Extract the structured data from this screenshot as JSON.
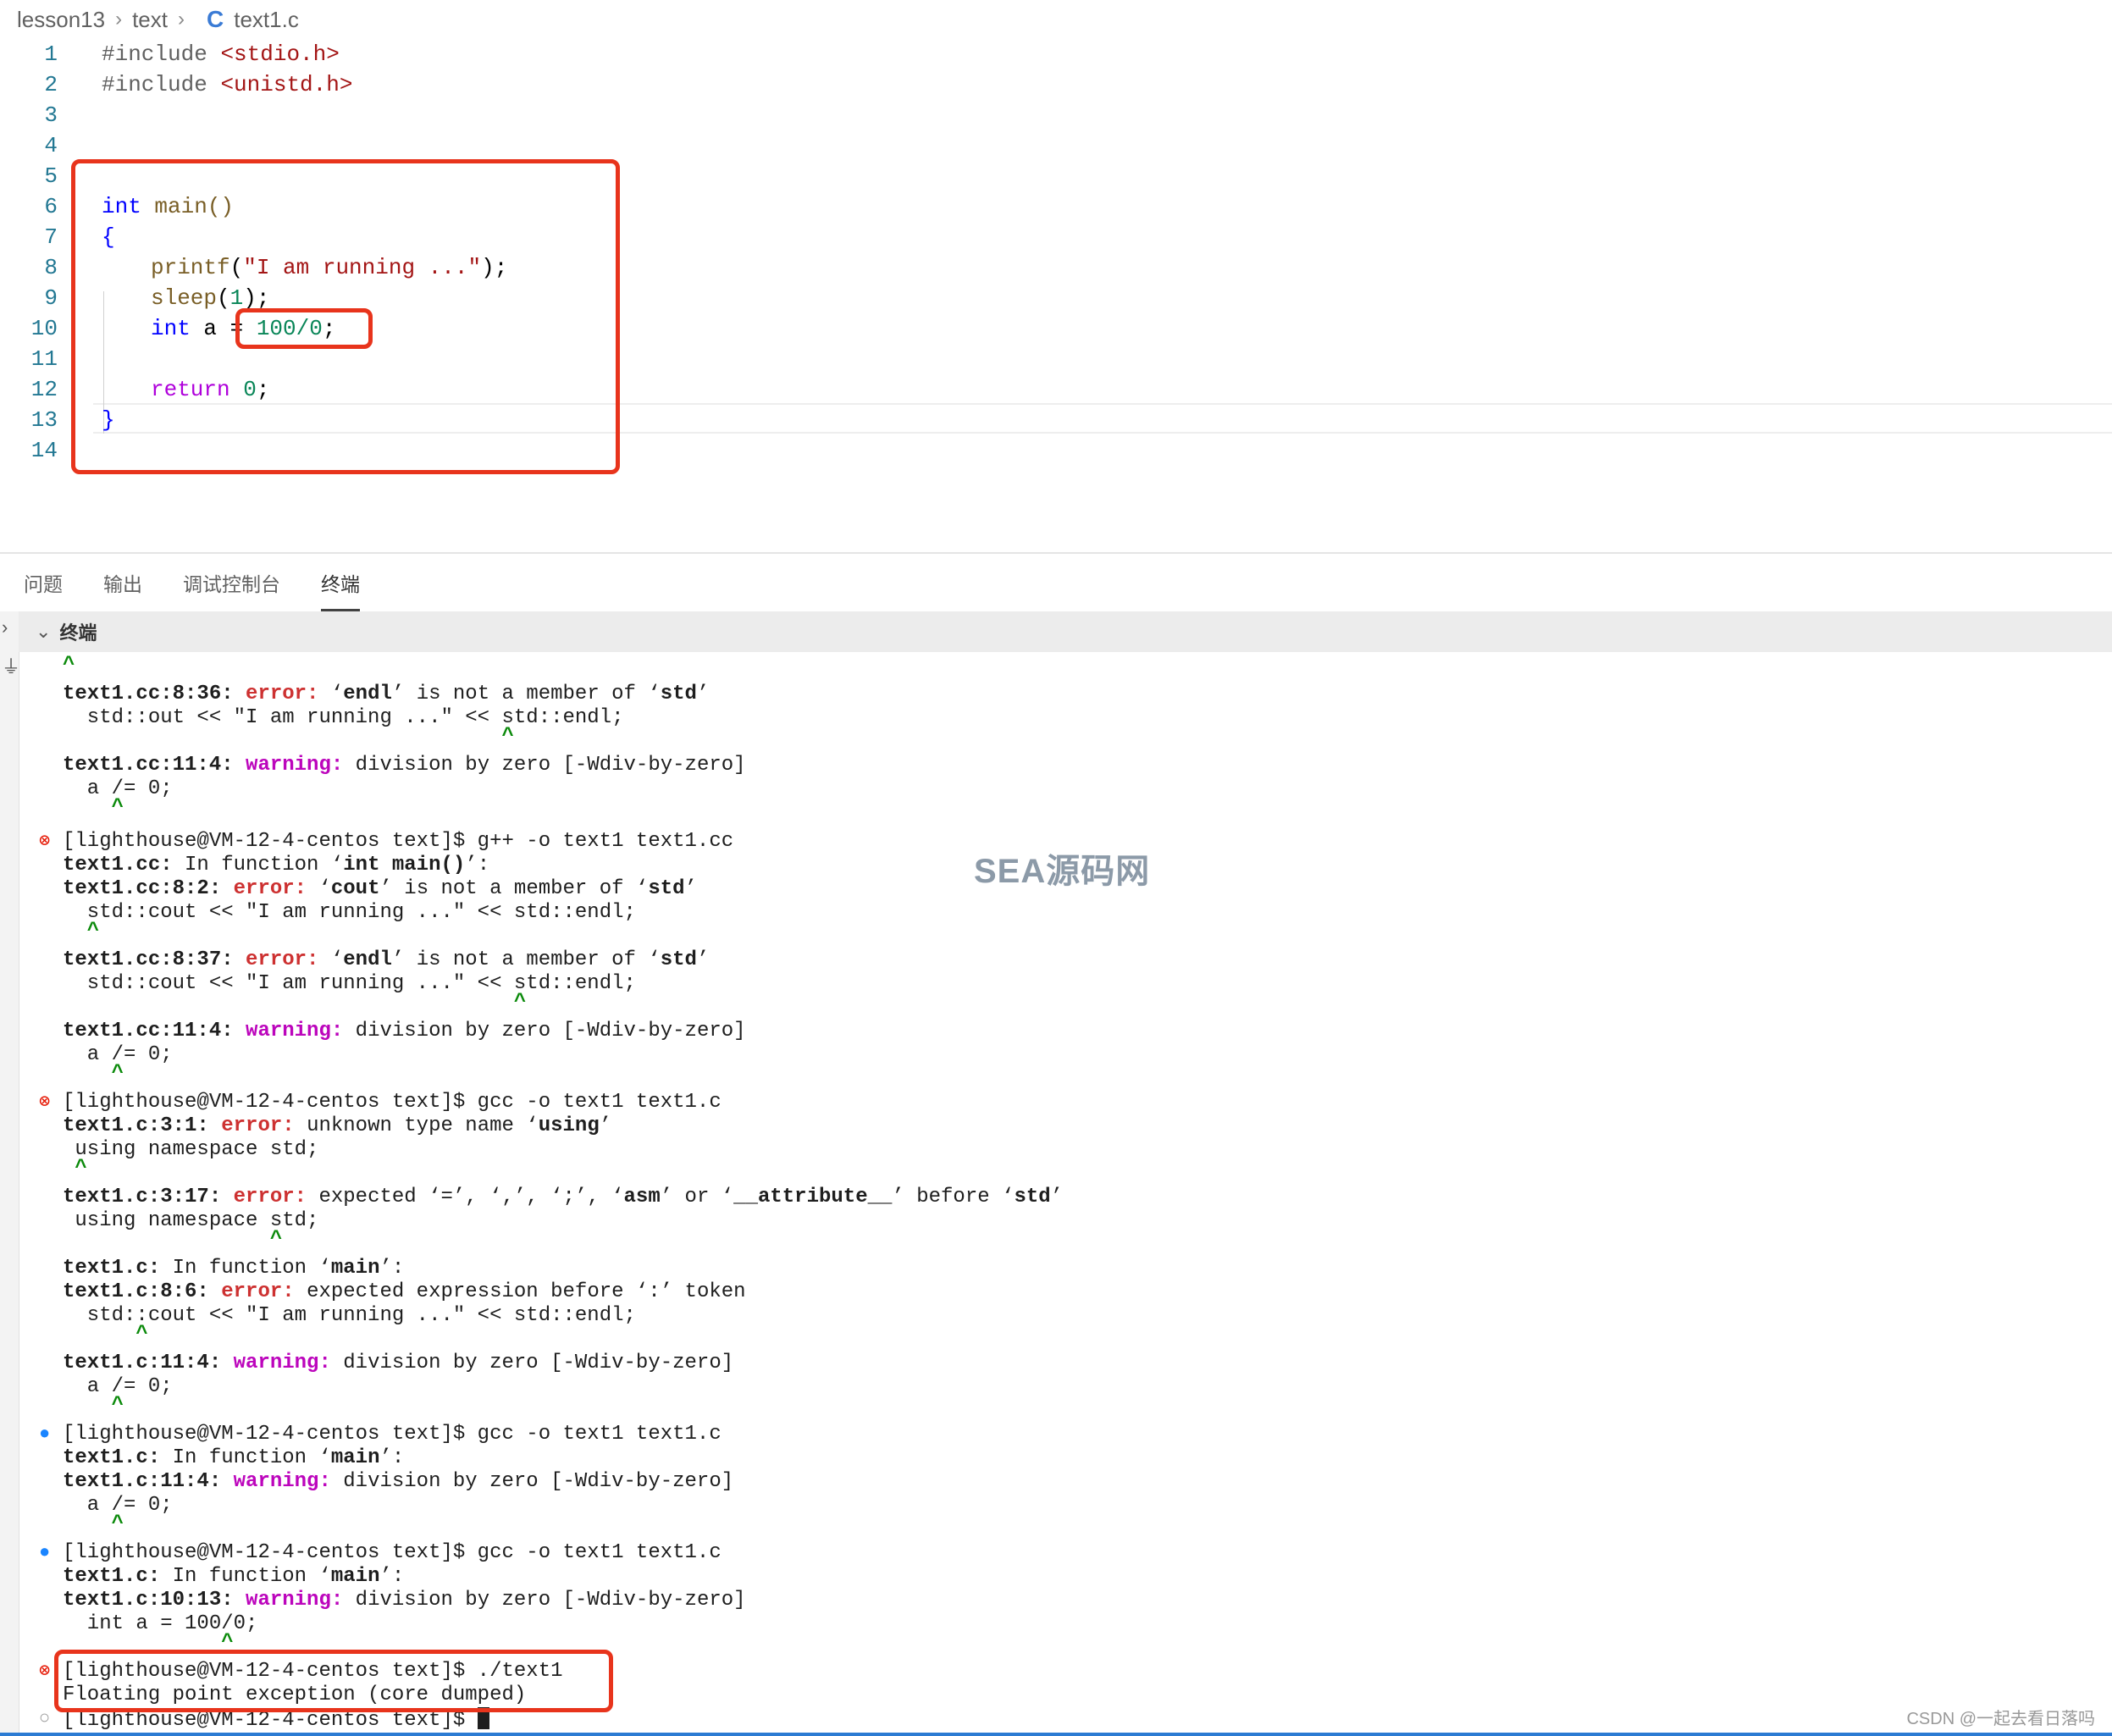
{
  "breadcrumb": {
    "folder1": "lesson13",
    "folder2": "text",
    "file_icon": "C",
    "file": "text1.c"
  },
  "editor": {
    "lines": [
      {
        "n": "1"
      },
      {
        "n": "2"
      },
      {
        "n": "3"
      },
      {
        "n": "4"
      },
      {
        "n": "5"
      },
      {
        "n": "6"
      },
      {
        "n": "7"
      },
      {
        "n": "8"
      },
      {
        "n": "9"
      },
      {
        "n": "10"
      },
      {
        "n": "11"
      },
      {
        "n": "12"
      },
      {
        "n": "13"
      },
      {
        "n": "14"
      }
    ],
    "code": {
      "l1_pp": "#include ",
      "l1_hdr": "<stdio.h>",
      "l2_pp": "#include ",
      "l2_hdr": "<unistd.h>",
      "l6_kw": "int",
      "l6_rest": " main()",
      "l7": "{",
      "l8_fn": "printf",
      "l8_p1": "(",
      "l8_str": "\"I am running ...\"",
      "l8_p2": ");",
      "l9_fn": "sleep",
      "l9_p1": "(",
      "l9_num": "1",
      "l9_p2": ");",
      "l10_kw": "int",
      "l10_rest": " a = ",
      "l10_num": "100/0",
      "l10_end": ";",
      "l12_kw": "return",
      "l12_sp": " ",
      "l12_num": "0",
      "l12_end": ";",
      "l13": "}"
    }
  },
  "panel": {
    "tabs": [
      "问题",
      "输出",
      "调试控制台",
      "终端"
    ],
    "active_tab": "终端",
    "terminal_header": "终端"
  },
  "terminal": {
    "t1": "^",
    "t2_a": "text1.cc:8:36: ",
    "t2_b": "error: ",
    "t2_c": "‘",
    "t2_d": "endl",
    "t2_e": "’ is not a member of ‘",
    "t2_f": "std",
    "t2_g": "’",
    "t3": "  std::out << \"I am running ...\" << std::endl;",
    "t4": "                                    ^",
    "t5_a": "text1.cc:11:4: ",
    "t5_b": "warning: ",
    "t5_c": "division by zero [-Wdiv-by-zero]",
    "t6": "  a /= 0;",
    "t7": "    ^",
    "t8": "[lighthouse@VM-12-4-centos text]$ g++ -o text1 text1.cc",
    "t9_a": "text1.cc: ",
    "t9_b": "In function ‘",
    "t9_c": "int main()",
    "t9_d": "’:",
    "t10_a": "text1.cc:8:2: ",
    "t10_b": "error: ",
    "t10_c": "‘",
    "t10_d": "cout",
    "t10_e": "’ is not a member of ‘",
    "t10_f": "std",
    "t10_g": "’",
    "t11": "  std::cout << \"I am running ...\" << std::endl;",
    "t12": "  ^",
    "t13_a": "text1.cc:8:37: ",
    "t13_b": "error: ",
    "t13_c": "‘",
    "t13_d": "endl",
    "t13_e": "’ is not a member of ‘",
    "t13_f": "std",
    "t13_g": "’",
    "t14": "  std::cout << \"I am running ...\" << std::endl;",
    "t15": "                                     ^",
    "t16_a": "text1.cc:11:4: ",
    "t16_b": "warning: ",
    "t16_c": "division by zero [-Wdiv-by-zero]",
    "t17": "  a /= 0;",
    "t18": "    ^",
    "t19": "[lighthouse@VM-12-4-centos text]$ gcc -o text1 text1.c",
    "t20_a": "text1.c:3:1: ",
    "t20_b": "error: ",
    "t20_c": "unknown type name ‘",
    "t20_d": "using",
    "t20_e": "’",
    "t21": " using namespace std;",
    "t22": " ^",
    "t23_a": "text1.c:3:17: ",
    "t23_b": "error: ",
    "t23_c": "expected ‘=’, ‘,’, ‘;’, ‘",
    "t23_d": "asm",
    "t23_e": "’ or ‘",
    "t23_f": "__attribute__",
    "t23_g": "’ before ‘",
    "t23_h": "std",
    "t23_i": "’",
    "t24": " using namespace std;",
    "t25": "                 ^",
    "t26_a": "text1.c: ",
    "t26_b": "In function ‘",
    "t26_c": "main",
    "t26_d": "’:",
    "t27_a": "text1.c:8:6: ",
    "t27_b": "error: ",
    "t27_c": "expected expression before ‘:’ token",
    "t28": "  std::cout << \"I am running ...\" << std::endl;",
    "t29": "      ^",
    "t30_a": "text1.c:11:4: ",
    "t30_b": "warning: ",
    "t30_c": "division by zero [-Wdiv-by-zero]",
    "t31": "  a /= 0;",
    "t32": "    ^",
    "t33": "[lighthouse@VM-12-4-centos text]$ gcc -o text1 text1.c",
    "t34_a": "text1.c: ",
    "t34_b": "In function ‘",
    "t34_c": "main",
    "t34_d": "’:",
    "t35_a": "text1.c:11:4: ",
    "t35_b": "warning: ",
    "t35_c": "division by zero [-Wdiv-by-zero]",
    "t36": "  a /= 0;",
    "t37": "    ^",
    "t38": "[lighthouse@VM-12-4-centos text]$ gcc -o text1 text1.c",
    "t39_a": "text1.c: ",
    "t39_b": "In function ‘",
    "t39_c": "main",
    "t39_d": "’:",
    "t40_a": "text1.c:10:13: ",
    "t40_b": "warning: ",
    "t40_c": "division by zero [-Wdiv-by-zero]",
    "t41": "  int a = 100/0;",
    "t42": "             ^",
    "t43": "[lighthouse@VM-12-4-centos text]$ ./text1",
    "t44": "Floating point exception (core dumped)",
    "t45": "[lighthouse@VM-12-4-centos text]$ "
  },
  "watermark": "SEA源码网",
  "credit": "CSDN @一起去看日落吗",
  "colors": {
    "highlight_box": "#e8341c",
    "error": "#cd3131",
    "warning": "#bc05bc",
    "caret": "#0b8a0b",
    "keyword": "#0000ff",
    "string": "#a31515",
    "number": "#098658"
  }
}
